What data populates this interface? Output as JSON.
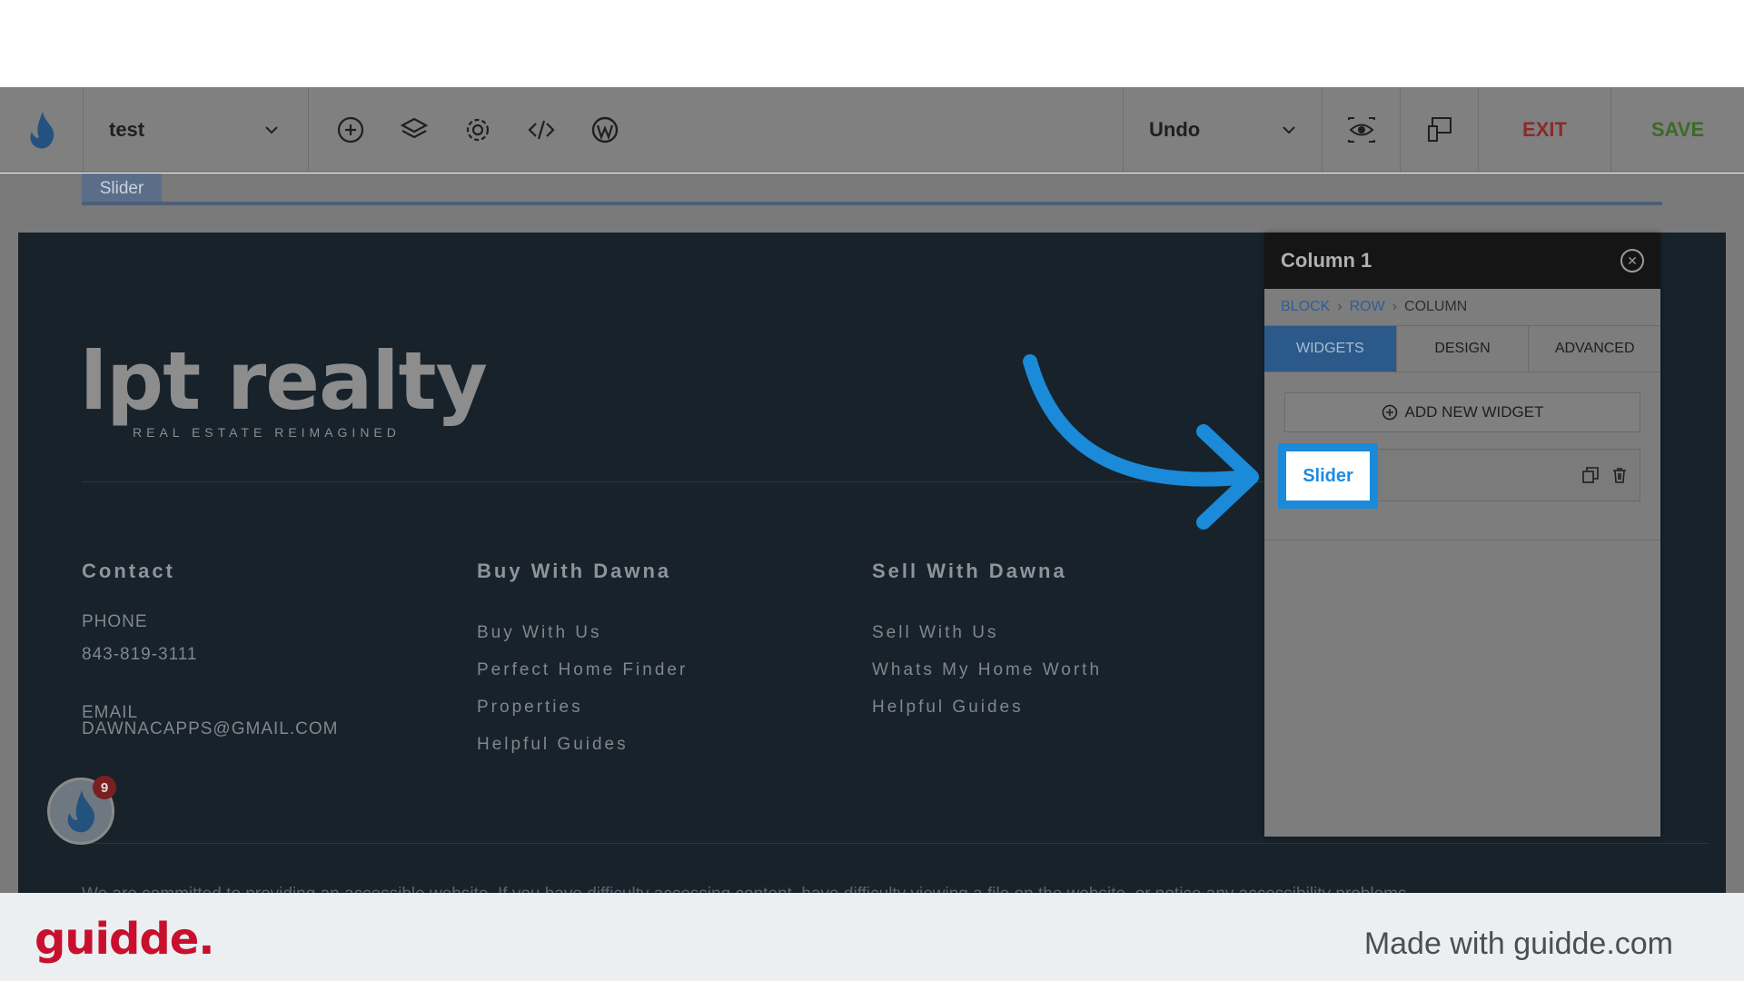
{
  "toolbar": {
    "page_name": "test",
    "undo_label": "Undo",
    "exit_label": "EXIT",
    "save_label": "SAVE"
  },
  "canvas": {
    "selected_tag": "Slider"
  },
  "footer": {
    "logo_main": "lpt realty",
    "logo_tagline": "REAL ESTATE REIMAGINED",
    "contact": {
      "heading": "Contact",
      "phone_label": "PHONE",
      "phone_value": "843-819-3111",
      "email_label": "EMAIL",
      "email_value": "DAWNACAPPS@GMAIL.COM"
    },
    "buy": {
      "heading": "Buy With Dawna",
      "links": [
        "Buy With Us",
        "Perfect Home Finder",
        "Properties",
        "Helpful Guides"
      ]
    },
    "sell": {
      "heading": "Sell With Dawna",
      "links": [
        "Sell With Us",
        "Whats My Home Worth",
        "Helpful Guides"
      ]
    },
    "bottom_text": "We are committed to providing an accessible website. If you have difficulty accessing content, have difficulty viewing a file on the website, or notice any accessibility problems"
  },
  "chat": {
    "badge_count": "9"
  },
  "panel": {
    "title": "Column 1",
    "breadcrumb": {
      "block": "BLOCK",
      "row": "ROW",
      "column": "COLUMN"
    },
    "tabs": [
      "WIDGETS",
      "DESIGN",
      "ADVANCED"
    ],
    "add_widget_label": "ADD NEW WIDGET",
    "widget_label": "Slider"
  },
  "brand": {
    "logo": "guidde.",
    "made_with": "Made with guidde.com"
  },
  "colors": {
    "accent_blue": "#1a8ad9",
    "exit_red": "#8c2a2a",
    "save_green": "#3c6a27",
    "brand_red": "#c8102e"
  }
}
